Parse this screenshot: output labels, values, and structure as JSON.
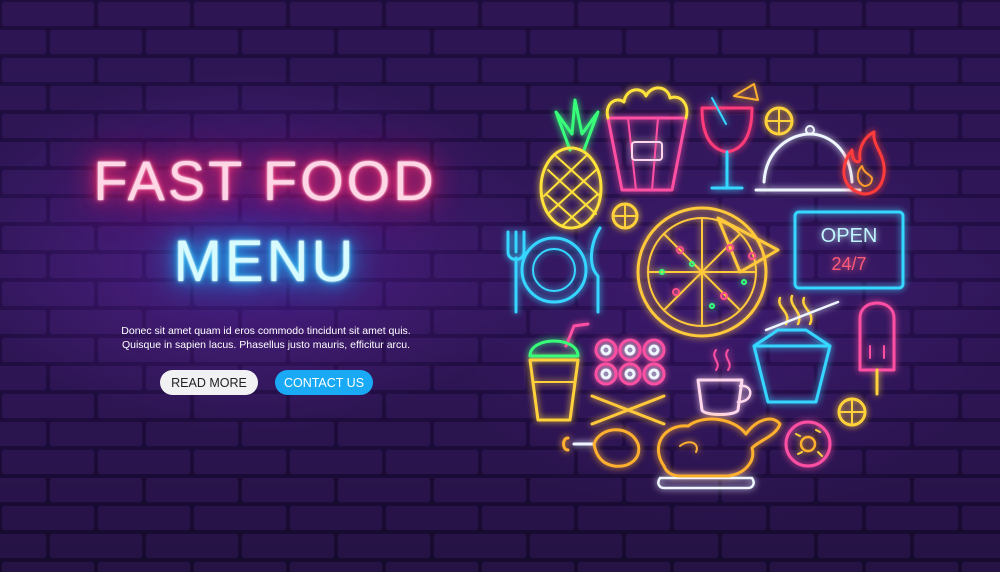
{
  "hero": {
    "title_line1": "FAST FOOD",
    "title_line2": "MENU"
  },
  "description": {
    "line1": "Donec sit amet quam id eros commodo tincidunt sit amet quis.",
    "line2": "Quisque in sapien lacus. Phasellus justo mauris, efficitur arcu."
  },
  "buttons": {
    "read_more": "READ MORE",
    "contact_us": "CONTACT US"
  },
  "sign": {
    "line1": "OPEN",
    "line2": "24/7"
  },
  "colors": {
    "title_pink": "#ff2a6d",
    "title_blue": "#1fb3ff",
    "wall": "#2b1257",
    "contact_button": "#19a9f5"
  },
  "icons": [
    "pineapple-icon",
    "popcorn-icon",
    "cocktail-icon",
    "lemon-slice-icon",
    "cloche-icon",
    "fire-icon",
    "plate-cutlery-icon",
    "pizza-icon",
    "open-sign-icon",
    "noodles-box-icon",
    "popsicle-icon",
    "soda-cup-icon",
    "sushi-icon",
    "chopsticks-icon",
    "coffee-cup-icon",
    "chicken-leg-icon",
    "roast-chicken-icon",
    "donut-icon"
  ]
}
